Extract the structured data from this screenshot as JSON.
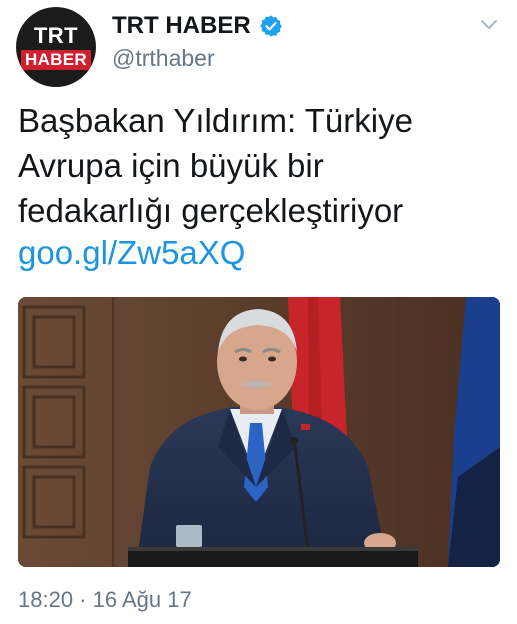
{
  "account": {
    "display_name": "TRT HABER",
    "handle": "@trthaber",
    "logo_top": "TRT",
    "logo_bottom": "HABER",
    "verified_icon": "verified-badge-icon"
  },
  "tweet": {
    "text_lines": [
      "Başbakan Yıldırım: Türkiye",
      "Avrupa için büyük bir",
      "fedakarlığı gerçekleştiriyor"
    ],
    "link": "goo.gl/Zw5aXQ",
    "timestamp": "18:20 · 16 Ağu 17"
  },
  "colors": {
    "link": "#1b95e0",
    "secondary_text": "#657786",
    "primary_text": "#14171a",
    "verified": "#1da1f2",
    "logo_red": "#d0202e"
  }
}
